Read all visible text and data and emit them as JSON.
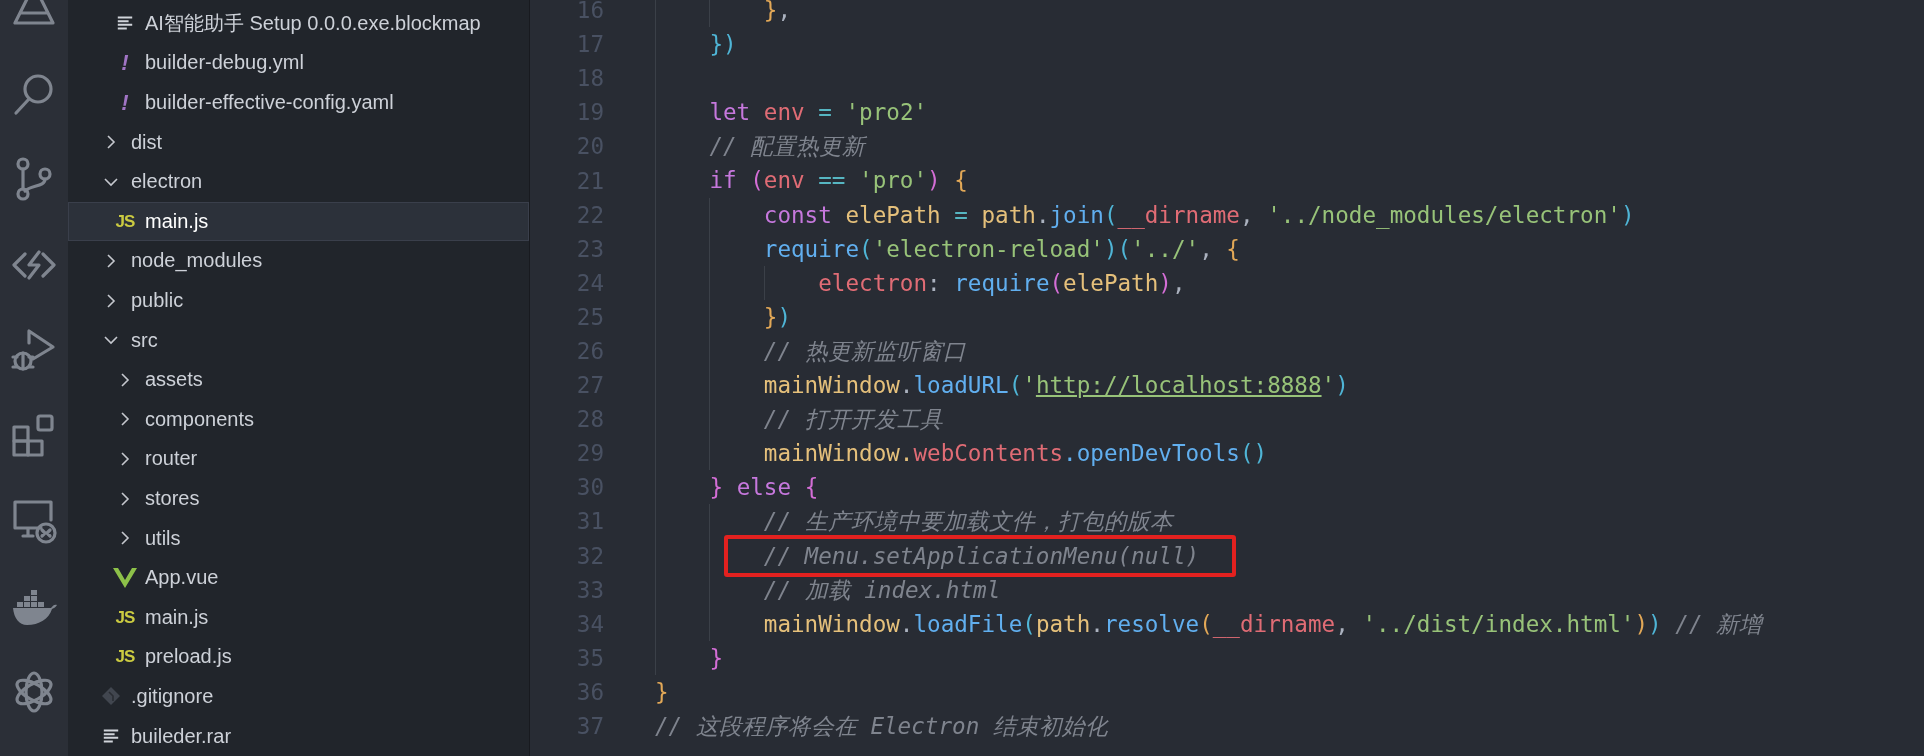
{
  "explorer": {
    "items": [
      {
        "children": [
          {
            "label": "AI智能助手 Setup 0.0.0.exe.blockmap",
            "kind": "lines",
            "selected": false
          },
          {
            "label": "builder-debug.yml",
            "kind": "yaml",
            "glyph": "!",
            "selected": false
          },
          {
            "label": "builder-effective-config.yaml",
            "kind": "yaml",
            "glyph": "!",
            "selected": false
          }
        ]
      },
      {
        "label": "dist",
        "kind": "folder",
        "expanded": false,
        "selected": false
      },
      {
        "label": "electron",
        "kind": "folder",
        "expanded": true,
        "selected": false,
        "children": [
          {
            "label": "main.js",
            "kind": "js",
            "glyph": "JS",
            "selected": true
          }
        ]
      },
      {
        "label": "node_modules",
        "kind": "folder",
        "expanded": false,
        "selected": false
      },
      {
        "label": "public",
        "kind": "folder",
        "expanded": false,
        "selected": false
      },
      {
        "label": "src",
        "kind": "folder",
        "expanded": true,
        "selected": false,
        "children": [
          {
            "label": "assets",
            "kind": "folder",
            "expanded": false,
            "selected": false
          },
          {
            "label": "components",
            "kind": "folder",
            "expanded": false,
            "selected": false
          },
          {
            "label": "router",
            "kind": "folder",
            "expanded": false,
            "selected": false
          },
          {
            "label": "stores",
            "kind": "folder",
            "expanded": false,
            "selected": false
          },
          {
            "label": "utils",
            "kind": "folder",
            "expanded": false,
            "selected": false
          },
          {
            "label": "App.vue",
            "kind": "vue",
            "selected": false
          },
          {
            "label": "main.js",
            "kind": "js",
            "glyph": "JS",
            "selected": false
          },
          {
            "label": "preload.js",
            "kind": "js",
            "glyph": "JS",
            "selected": false
          }
        ]
      },
      {
        "label": ".gitignore",
        "kind": "git",
        "selected": false
      },
      {
        "label": "buileder.rar",
        "kind": "lines",
        "selected": false
      }
    ]
  },
  "editor": {
    "lines": [
      {
        "children": [
          {
            "children": [
              {
                "number": "16",
                "boxed": false,
                "tokens": [
                  {
                    "text": "}",
                    "kind": "b1"
                  },
                  {
                    "text": ",",
                    "kind": "p"
                  }
                ]
              }
            ]
          },
          {
            "number": "17",
            "boxed": false,
            "tokens": [
              {
                "text": "})",
                "kind": "b3"
              }
            ]
          },
          {
            "number": "18",
            "boxed": false
          },
          {
            "number": "19",
            "boxed": false,
            "tokens": [
              {
                "text": "let ",
                "kind": "kw"
              },
              {
                "text": "env ",
                "kind": "var"
              },
              {
                "text": "= ",
                "kind": "op"
              },
              {
                "text": "'pro2'",
                "kind": "str"
              }
            ]
          },
          {
            "number": "20",
            "boxed": false,
            "tokens": [
              {
                "text": "// 配置热更新",
                "kind": "c"
              }
            ]
          },
          {
            "number": "21",
            "boxed": false,
            "tokens": [
              {
                "text": "if ",
                "kind": "kw"
              },
              {
                "text": "(",
                "kind": "b2"
              },
              {
                "text": "env ",
                "kind": "var"
              },
              {
                "text": "== ",
                "kind": "op"
              },
              {
                "text": "'pro'",
                "kind": "str"
              },
              {
                "text": ") ",
                "kind": "b2"
              },
              {
                "text": "{",
                "kind": "b1"
              }
            ],
            "children": [
              {
                "number": "22",
                "boxed": false,
                "tokens": [
                  {
                    "text": "const ",
                    "kind": "kw"
                  },
                  {
                    "text": "elePath ",
                    "kind": "obj"
                  },
                  {
                    "text": "= ",
                    "kind": "op"
                  },
                  {
                    "text": "path",
                    "kind": "obj"
                  },
                  {
                    "text": ".",
                    "kind": "p"
                  },
                  {
                    "text": "join",
                    "kind": "fn"
                  },
                  {
                    "text": "(",
                    "kind": "b3"
                  },
                  {
                    "text": "__dirname",
                    "kind": "var"
                  },
                  {
                    "text": ", ",
                    "kind": "p"
                  },
                  {
                    "text": "'../node_modules/electron'",
                    "kind": "str"
                  },
                  {
                    "text": ")",
                    "kind": "b3"
                  }
                ]
              },
              {
                "number": "23",
                "boxed": false,
                "tokens": [
                  {
                    "text": "require",
                    "kind": "fn"
                  },
                  {
                    "text": "(",
                    "kind": "b3"
                  },
                  {
                    "text": "'electron-reload'",
                    "kind": "str"
                  },
                  {
                    "text": ")(",
                    "kind": "b3"
                  },
                  {
                    "text": "'../'",
                    "kind": "str"
                  },
                  {
                    "text": ", ",
                    "kind": "p"
                  },
                  {
                    "text": "{",
                    "kind": "b1"
                  }
                ],
                "children": [
                  {
                    "number": "24",
                    "boxed": false,
                    "tokens": [
                      {
                        "text": "electron",
                        "kind": "var"
                      },
                      {
                        "text": ": ",
                        "kind": "p"
                      },
                      {
                        "text": "require",
                        "kind": "fn"
                      },
                      {
                        "text": "(",
                        "kind": "b2"
                      },
                      {
                        "text": "elePath",
                        "kind": "obj"
                      },
                      {
                        "text": ")",
                        "kind": "b2"
                      },
                      {
                        "text": ",",
                        "kind": "p"
                      }
                    ]
                  }
                ]
              },
              {
                "number": "25",
                "boxed": false,
                "tokens": [
                  {
                    "text": "}",
                    "kind": "b1"
                  },
                  {
                    "text": ")",
                    "kind": "b3"
                  }
                ]
              },
              {
                "number": "26",
                "boxed": false,
                "tokens": [
                  {
                    "text": "// 热更新监听窗口",
                    "kind": "c"
                  }
                ]
              },
              {
                "number": "27",
                "boxed": false,
                "tokens": [
                  {
                    "text": "mainWindow",
                    "kind": "obj"
                  },
                  {
                    "text": ".",
                    "kind": "p"
                  },
                  {
                    "text": "loadURL",
                    "kind": "fn"
                  },
                  {
                    "text": "(",
                    "kind": "b3"
                  },
                  {
                    "text": "'",
                    "kind": "str"
                  },
                  {
                    "text": "http://localhost:8888",
                    "kind": "link"
                  },
                  {
                    "text": "'",
                    "kind": "str"
                  },
                  {
                    "text": ")",
                    "kind": "b3"
                  }
                ]
              },
              {
                "number": "28",
                "boxed": false,
                "tokens": [
                  {
                    "text": "// 打开开发工具",
                    "kind": "c"
                  }
                ]
              },
              {
                "number": "29",
                "boxed": false,
                "tokens": [
                  {
                    "text": "mainWindow.",
                    "kind": "obj"
                  },
                  {
                    "text": "webContents",
                    "kind": "var"
                  },
                  {
                    "text": ".openDevTools",
                    "kind": "fn"
                  },
                  {
                    "text": "()",
                    "kind": "b3"
                  }
                ]
              }
            ]
          },
          {
            "number": "30",
            "boxed": false,
            "tokens": [
              {
                "text": "} ",
                "kind": "b2"
              },
              {
                "text": "else ",
                "kind": "kw"
              },
              {
                "text": "{",
                "kind": "b2"
              }
            ],
            "children": [
              {
                "number": "31",
                "boxed": false,
                "tokens": [
                  {
                    "text": "// 生产环境中要加载文件，打包的版本",
                    "kind": "c"
                  }
                ]
              },
              {
                "number": "32",
                "boxed": true,
                "tokens": [
                  {
                    "text": "// Menu.setApplicationMenu(null)",
                    "kind": "c"
                  }
                ]
              },
              {
                "number": "33",
                "boxed": false,
                "tokens": [
                  {
                    "text": "// 加载 index.html",
                    "kind": "c"
                  }
                ]
              },
              {
                "number": "34",
                "boxed": false,
                "tokens": [
                  {
                    "text": "mainWindow",
                    "kind": "obj"
                  },
                  {
                    "text": ".",
                    "kind": "p"
                  },
                  {
                    "text": "loadFile",
                    "kind": "fn"
                  },
                  {
                    "text": "(",
                    "kind": "b3"
                  },
                  {
                    "text": "path",
                    "kind": "obj"
                  },
                  {
                    "text": ".",
                    "kind": "p"
                  },
                  {
                    "text": "resolve",
                    "kind": "fn"
                  },
                  {
                    "text": "(",
                    "kind": "b1"
                  },
                  {
                    "text": "__dirname",
                    "kind": "var"
                  },
                  {
                    "text": ", ",
                    "kind": "p"
                  },
                  {
                    "text": "'../dist/index.html'",
                    "kind": "str"
                  },
                  {
                    "text": ")",
                    "kind": "b1"
                  },
                  {
                    "text": ") ",
                    "kind": "b3"
                  },
                  {
                    "text": "// 新增",
                    "kind": "c"
                  }
                ]
              }
            ]
          },
          {
            "number": "35",
            "boxed": false,
            "tokens": [
              {
                "text": "}",
                "kind": "b2"
              }
            ]
          }
        ]
      },
      {
        "number": "36",
        "boxed": false,
        "tokens": [
          {
            "text": "}",
            "kind": "b1"
          }
        ]
      },
      {
        "number": "37",
        "boxed": false,
        "tokens": [
          {
            "text": "// 这段程序将会在 Electron 结束初始化",
            "kind": "c"
          }
        ]
      }
    ]
  }
}
